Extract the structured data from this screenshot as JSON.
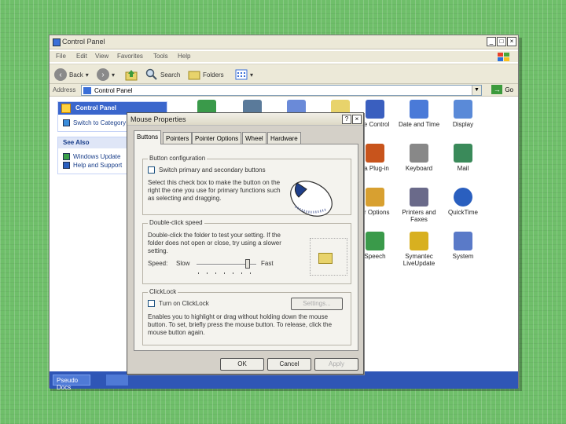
{
  "window": {
    "title": "Control Panel",
    "min": "_",
    "max": "□",
    "close": "×"
  },
  "menu": [
    "File",
    "Edit",
    "View",
    "Favorites",
    "Tools",
    "Help"
  ],
  "toolbar": {
    "back": "Back",
    "search": "Search",
    "folders": "Folders"
  },
  "address": {
    "label": "Address",
    "value": "Control Panel",
    "go": "Go"
  },
  "left_pane": {
    "panel_title": "Control Panel",
    "switch_link": "Switch to Category",
    "see_also": "See Also",
    "links": [
      "Windows Update",
      "Help and Support"
    ]
  },
  "icons": [
    {
      "label": "ce Control",
      "color": "#3a5fbf"
    },
    {
      "label": "Date and Time",
      "color": "#4a7ad8"
    },
    {
      "label": "Display",
      "color": "#5a8ad8"
    },
    {
      "label": "va Plug-in",
      "color": "#c8541c"
    },
    {
      "label": "Keyboard",
      "color": "#888888"
    },
    {
      "label": "Mail",
      "color": "#3a8a5a"
    },
    {
      "label": "er Options",
      "color": "#d8a030"
    },
    {
      "label": "Printers and Faxes",
      "color": "#6a6a8a"
    },
    {
      "label": "QuickTime",
      "color": "#2a5fbf"
    },
    {
      "label": "Speech",
      "color": "#3a9a4a"
    },
    {
      "label": "Symantec LiveUpdate",
      "color": "#d8b020"
    },
    {
      "label": "System",
      "color": "#5a7ac8"
    }
  ],
  "taskbar": {
    "button": "Pseudo Docs"
  },
  "dialog": {
    "title": "Mouse Properties",
    "help": "?",
    "close": "×",
    "tabs": [
      "Buttons",
      "Pointers",
      "Pointer Options",
      "Wheel",
      "Hardware"
    ],
    "button_config": {
      "legend": "Button configuration",
      "checkbox": "Switch primary and secondary buttons",
      "desc": "Select this check box to make the button on the right the one you use for primary functions such as selecting and dragging."
    },
    "double_click": {
      "legend": "Double-click speed",
      "desc": "Double-click the folder to test your setting. If the folder does not open or close, try using a slower setting.",
      "speed": "Speed:",
      "slow": "Slow",
      "fast": "Fast",
      "level": 0.85
    },
    "clicklock": {
      "legend": "ClickLock",
      "checkbox": "Turn on ClickLock",
      "settings": "Settings...",
      "desc": "Enables you to highlight or drag without holding down the mouse button. To set, briefly press the mouse button. To release, click the mouse button again."
    },
    "ok": "OK",
    "cancel": "Cancel",
    "apply": "Apply"
  }
}
